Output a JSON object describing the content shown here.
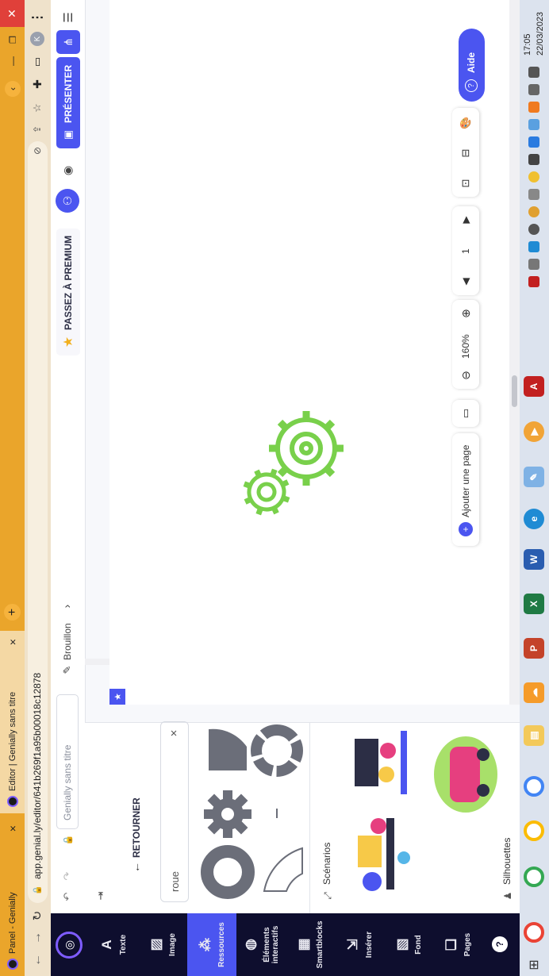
{
  "browser": {
    "tabs": [
      {
        "label": "Panel - Genially",
        "close": "×"
      },
      {
        "label": "Editor | Genially sans titre",
        "close": "×"
      }
    ],
    "new_tab": "+",
    "url": "app.genial.ly/editor/641b269f1a95b00018c12878",
    "profile_initial": "K",
    "menu": "⋮"
  },
  "topbar": {
    "title_placeholder": "Genially sans titre",
    "status": "Brouillon",
    "premium": "PASSEZ À PREMIUM",
    "present": "PRÉSENTER",
    "menu": "☰"
  },
  "sidebar": {
    "items": [
      {
        "label": "Texte",
        "icon": "text-icon"
      },
      {
        "label": "Image",
        "icon": "image-icon"
      },
      {
        "label": "Ressources",
        "icon": "resources-icon"
      },
      {
        "label": "Éléments interactifs",
        "icon": "interactive-icon"
      },
      {
        "label": "Smartblocks",
        "icon": "smartblocks-icon"
      },
      {
        "label": "Insérer",
        "icon": "insert-icon"
      },
      {
        "label": "Fond",
        "icon": "background-icon"
      },
      {
        "label": "Pages",
        "icon": "pages-icon"
      }
    ],
    "help": "?"
  },
  "panel": {
    "back": "RETOURNER",
    "search_value": "roue",
    "clear": "×",
    "section_scenarios": "Scénarios",
    "section_silhouettes": "Silhouettes"
  },
  "canvas_tools": {
    "add_page": "Ajouter une page",
    "zoom": "160%",
    "page_number": "1",
    "help": "Aide"
  },
  "taskbar": {
    "time": "17:05",
    "date": "22/03/2023"
  },
  "colors": {
    "accent": "#4b55f0",
    "nav_bg": "#0e0e2e",
    "gear": "#79d04b",
    "tab_bg": "#eaa52b",
    "premium_star": "#f2b01e"
  }
}
